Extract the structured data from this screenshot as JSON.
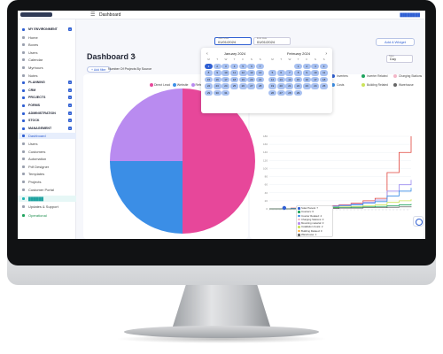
{
  "topbar": {
    "menu_icon": "menu-icon",
    "title": "Dashboard",
    "right_label": "████████"
  },
  "sidebar": {
    "items": [
      {
        "label": "MY ENVIRONMENT",
        "kind": "section"
      },
      {
        "label": "Home",
        "kind": "item"
      },
      {
        "label": "Boxes",
        "kind": "item"
      },
      {
        "label": "Users",
        "kind": "item"
      },
      {
        "label": "Calendar",
        "kind": "item"
      },
      {
        "label": "Myrhours",
        "kind": "item"
      },
      {
        "label": "Notes",
        "kind": "item"
      },
      {
        "label": "PLANNING",
        "kind": "section"
      },
      {
        "label": "CRM",
        "kind": "section"
      },
      {
        "label": "PROJECTS",
        "kind": "section"
      },
      {
        "label": "FORMS",
        "kind": "section"
      },
      {
        "label": "ADMINISTRATION",
        "kind": "section"
      },
      {
        "label": "STOCK",
        "kind": "section"
      },
      {
        "label": "MANAGEMENT",
        "kind": "section"
      },
      {
        "label": "Dashboard",
        "kind": "active"
      },
      {
        "label": "Users",
        "kind": "item"
      },
      {
        "label": "Customers",
        "kind": "item"
      },
      {
        "label": "Automation",
        "kind": "item"
      },
      {
        "label": "Pdf Designer",
        "kind": "item"
      },
      {
        "label": "Templates",
        "kind": "item"
      },
      {
        "label": "Projects",
        "kind": "item"
      },
      {
        "label": "Customer Portal",
        "kind": "item"
      },
      {
        "label": "██████",
        "kind": "highlight"
      },
      {
        "label": "Updates & Support",
        "kind": "item"
      },
      {
        "label": "Operational",
        "kind": "green"
      }
    ]
  },
  "dashboard": {
    "title": "Dashboard 3",
    "chip_label": "+ Add filter",
    "widget_title": "Number Of Projects By Source",
    "add_widget_label": "Add A Widget",
    "day_select": {
      "label": "Step",
      "value": "Day"
    }
  },
  "date_range": {
    "start_label": "Start date",
    "start_value": "01/01/2024",
    "end_label": "End date",
    "end_value": "01/01/2024"
  },
  "calendar": {
    "weekdays": [
      "M",
      "T",
      "W",
      "T",
      "F",
      "S",
      "S"
    ],
    "months": [
      {
        "title": "January 2024",
        "offset": 0,
        "days": 31,
        "selected": 1
      },
      {
        "title": "February 2024",
        "offset": 3,
        "days": 29,
        "selected": 0
      }
    ]
  },
  "pie_chart": {
    "legend": [
      {
        "name": "Direct Lead",
        "color": "#e7479a"
      },
      {
        "name": "Website",
        "color": "#3b8ee6"
      },
      {
        "name": "Referral",
        "color": "#b98bf0"
      }
    ]
  },
  "right_legend": [
    {
      "name": "Inverters",
      "color": "#2f5fd3"
    },
    {
      "name": "Inverter Related",
      "color": "#1ea35e"
    },
    {
      "name": "Charging Stations",
      "color": "#f2b6c8"
    },
    {
      "name": "Costs",
      "color": "#3b8ee6"
    },
    {
      "name": "Building Related",
      "color": "#cbe35a"
    },
    {
      "name": "Warehouse",
      "color": "#666666"
    }
  ],
  "tooltip": [
    {
      "name": "Solar Panels: 7",
      "color": "#2f5fd3"
    },
    {
      "name": "Inverters: 6",
      "color": "#1ea35e"
    },
    {
      "name": "Inverter Related: 4",
      "color": "#3b8ee6"
    },
    {
      "name": "Charging Stations: 0",
      "color": "#f2b6c8"
    },
    {
      "name": "Mounting material: 0",
      "color": "#b98bf0"
    },
    {
      "name": "Installation Costs: 2",
      "color": "#cbe35a"
    },
    {
      "name": "Building Related: 0",
      "color": "#ffb347"
    },
    {
      "name": "Warehouse: 1",
      "color": "#666666"
    }
  ],
  "chart_data": [
    {
      "type": "pie",
      "title": "Number Of Projects By Source",
      "labels": [
        "Direct Lead",
        "Website",
        "Referral"
      ],
      "values": [
        50,
        25,
        25
      ],
      "colors": [
        "#e7479a",
        "#3b8ee6",
        "#b98bf0"
      ]
    },
    {
      "type": "line",
      "x": [
        1,
        5,
        10,
        15,
        20,
        25,
        30,
        35,
        40,
        45,
        50,
        55,
        60
      ],
      "y_ticks": [
        0,
        20,
        40,
        60,
        80,
        100,
        120,
        140,
        160,
        180
      ],
      "ylim": [
        0,
        180
      ],
      "series": [
        {
          "name": "Inverters",
          "color": "#e0433b",
          "values": [
            0,
            0,
            2,
            4,
            6,
            8,
            10,
            14,
            20,
            26,
            90,
            140,
            180
          ]
        },
        {
          "name": "Costs",
          "color": "#9c8cf0",
          "values": [
            0,
            0,
            1,
            3,
            5,
            7,
            9,
            12,
            16,
            22,
            44,
            60,
            72
          ]
        },
        {
          "name": "Inverter Related",
          "color": "#3b8ee6",
          "values": [
            0,
            0,
            1,
            2,
            4,
            6,
            8,
            10,
            14,
            18,
            32,
            44,
            52
          ]
        },
        {
          "name": "Building Related",
          "color": "#cbe35a",
          "values": [
            0,
            0,
            0,
            1,
            2,
            4,
            5,
            6,
            8,
            10,
            16,
            20,
            24
          ]
        },
        {
          "name": "Inverters Green",
          "color": "#1ea35e",
          "values": [
            0,
            0,
            0,
            1,
            2,
            3,
            3,
            4,
            5,
            6,
            8,
            10,
            12
          ]
        },
        {
          "name": "Warehouse",
          "color": "#666666",
          "values": [
            0,
            0,
            0,
            0,
            1,
            1,
            2,
            2,
            3,
            3,
            4,
            5,
            6
          ]
        }
      ]
    }
  ]
}
